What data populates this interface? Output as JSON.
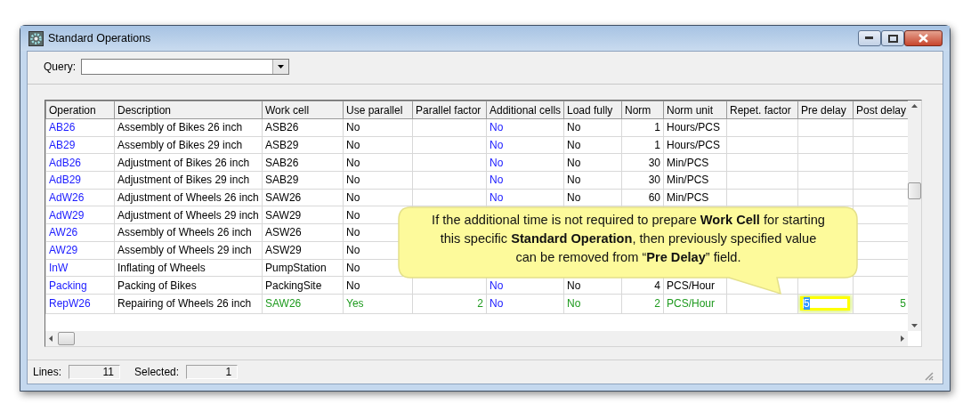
{
  "window": {
    "title": "Standard Operations"
  },
  "query": {
    "label": "Query:"
  },
  "table": {
    "columns": [
      {
        "label": "Operation",
        "kind": "link"
      },
      {
        "label": "Description",
        "kind": "label"
      },
      {
        "label": "Work cell",
        "kind": "text"
      },
      {
        "label": "Use parallel",
        "kind": "text"
      },
      {
        "label": "Parallel factor",
        "kind": "number"
      },
      {
        "label": "Additional cells",
        "kind": "link"
      },
      {
        "label": "Load fully",
        "kind": "text"
      },
      {
        "label": "Norm",
        "kind": "number"
      },
      {
        "label": "Norm unit",
        "kind": "text"
      },
      {
        "label": "Repet. factor",
        "kind": "number"
      },
      {
        "label": "Pre delay",
        "kind": "number"
      },
      {
        "label": "Post delay",
        "kind": "number"
      }
    ],
    "rows": [
      {
        "selected": false,
        "cells": [
          "AB26",
          "Assembly of Bikes 26 inch",
          "ASB26",
          "No",
          null,
          "No",
          "No",
          "1",
          "Hours/PCS",
          null,
          null,
          null
        ]
      },
      {
        "selected": false,
        "cells": [
          "AB29",
          "Assembly of Bikes 29 inch",
          "ASB29",
          "No",
          null,
          "No",
          "No",
          "1",
          "Hours/PCS",
          null,
          null,
          null
        ]
      },
      {
        "selected": false,
        "cells": [
          "AdB26",
          "Adjustment of Bikes 26 inch",
          "SAB26",
          "No",
          null,
          "No",
          "No",
          "30",
          "Min/PCS",
          null,
          null,
          null
        ]
      },
      {
        "selected": false,
        "cells": [
          "AdB29",
          "Adjustment of Bikes 29 inch",
          "SAB29",
          "No",
          null,
          "No",
          "No",
          "30",
          "Min/PCS",
          null,
          null,
          null
        ]
      },
      {
        "selected": false,
        "cells": [
          "AdW26",
          "Adjustment of Wheels 26 inch",
          "SAW26",
          "No",
          null,
          "No",
          "No",
          "60",
          "Min/PCS",
          null,
          null,
          null
        ]
      },
      {
        "selected": false,
        "cells": [
          "AdW29",
          "Adjustment of Wheels 29 inch",
          "SAW29",
          "No",
          null,
          null,
          null,
          null,
          null,
          null,
          null,
          null
        ]
      },
      {
        "selected": false,
        "cells": [
          "AW26",
          "Assembly of Wheels 26 inch",
          "ASW26",
          "No",
          null,
          null,
          null,
          null,
          null,
          null,
          null,
          null
        ]
      },
      {
        "selected": false,
        "cells": [
          "AW29",
          "Assembly of Wheels 29 inch",
          "ASW29",
          "No",
          null,
          null,
          null,
          null,
          null,
          null,
          null,
          null
        ]
      },
      {
        "selected": false,
        "cells": [
          "InW",
          "Inflating of Wheels",
          "PumpStation",
          "No",
          null,
          null,
          null,
          null,
          null,
          null,
          null,
          null
        ]
      },
      {
        "selected": false,
        "cells": [
          "Packing",
          "Packing of Bikes",
          "PackingSite",
          "No",
          null,
          "No",
          "No",
          "4",
          "PCS/Hour",
          null,
          null,
          null
        ]
      },
      {
        "selected": true,
        "cells": [
          "RepW26",
          "Repairing of Wheels 26 inch",
          "SAW26",
          "Yes",
          "2",
          "No",
          "No",
          "2",
          "PCS/Hour",
          null,
          {
            "value": "5",
            "editing": true
          },
          "5"
        ]
      }
    ]
  },
  "callout": {
    "text": "If the additional time is not required to prepare **Work Cell** for starting this specific **Standard Operation**, then previously specified value can be removed from “**Pre Delay**” field."
  },
  "status_bar": [
    {
      "label": "Lines:",
      "value": "11"
    },
    {
      "label": "Selected:",
      "value": "1"
    }
  ]
}
